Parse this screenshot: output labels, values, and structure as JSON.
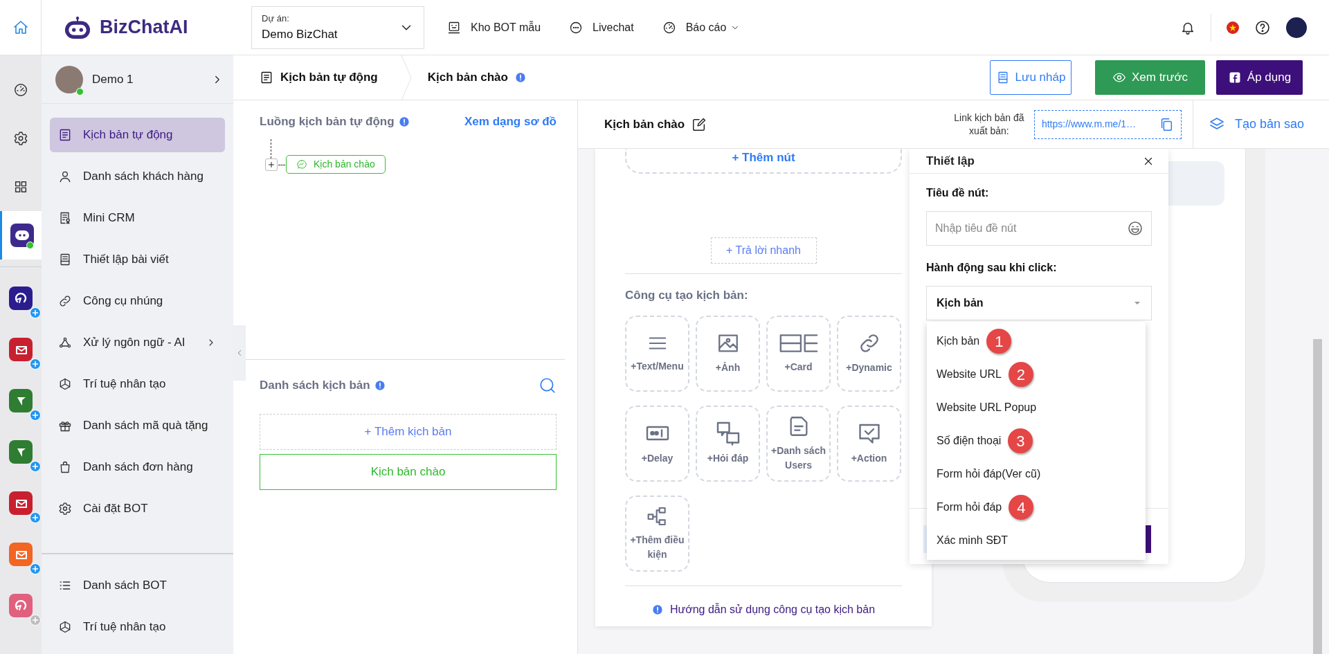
{
  "header": {
    "logo": "BizChatAI",
    "project": {
      "label": "Dự án:",
      "value": "Demo BizChat"
    },
    "nav": [
      {
        "label": "Kho BOT mẫu",
        "dropdown": false
      },
      {
        "label": "Livechat",
        "dropdown": false
      },
      {
        "label": "Báo cáo",
        "dropdown": true
      }
    ]
  },
  "rail": {
    "items": [
      {
        "selected": false,
        "online": false
      },
      {
        "selected": false,
        "online": false
      },
      {
        "selected": false,
        "online": false
      },
      {
        "selected": true,
        "online": true
      }
    ],
    "apps": [
      {
        "color": "#2b1d8e",
        "enabled": true
      },
      {
        "color": "#c8202f",
        "enabled": true
      },
      {
        "color": "#2e7d32",
        "enabled": true
      },
      {
        "color": "#2e7d32",
        "enabled": true
      },
      {
        "color": "#c8202f",
        "enabled": true
      },
      {
        "color": "#f26522",
        "enabled": true
      },
      {
        "color": "#e0607e",
        "enabled": false
      }
    ]
  },
  "sidebar": {
    "profile": {
      "name": "Demo 1",
      "online": true
    },
    "items": [
      {
        "label": "Kịch bản tự động",
        "selected": true,
        "submenu": false
      },
      {
        "label": "Danh sách khách hàng",
        "selected": false,
        "submenu": false
      },
      {
        "label": "Mini CRM",
        "selected": false,
        "submenu": false
      },
      {
        "label": "Thiết lập bài viết",
        "selected": false,
        "submenu": false
      },
      {
        "label": "Công cụ nhúng",
        "selected": false,
        "submenu": false
      },
      {
        "label": "Xử lý ngôn ngữ - AI",
        "selected": false,
        "submenu": true
      },
      {
        "label": "Trí tuệ nhân tạo",
        "selected": false,
        "submenu": false
      },
      {
        "label": "Danh sách mã quà tặng",
        "selected": false,
        "submenu": false
      },
      {
        "label": "Danh sách đơn hàng",
        "selected": false,
        "submenu": false
      },
      {
        "label": "Cài đặt BOT",
        "selected": false,
        "submenu": false
      }
    ],
    "bottom_items": [
      {
        "label": "Danh sách BOT",
        "selected": false
      },
      {
        "label": "Trí tuệ nhân tạo",
        "selected": false
      }
    ]
  },
  "breadcrumb": [
    {
      "label": "Kịch bản tự động",
      "info": false
    },
    {
      "label": "Kịch bản chào",
      "info": true
    }
  ],
  "actions": [
    {
      "label": "Lưu nháp",
      "kind": "draft"
    },
    {
      "label": "Xem trước",
      "kind": "preview"
    },
    {
      "label": "Áp dụng",
      "kind": "apply"
    }
  ],
  "flow": {
    "title": "Luồng kịch bản tự động",
    "view_link": "Xem dạng sơ đồ",
    "tree": [
      {
        "label": "Kịch bản chào"
      }
    ]
  },
  "scripts": {
    "title": "Danh sách kịch bản",
    "add": "+ Thêm kịch bản",
    "items": [
      {
        "label": "Kịch bản chào",
        "selected": true
      }
    ]
  },
  "editor": {
    "title": "Kịch bản chào",
    "link_label": "Link kịch bản đã xuất bản:",
    "link": "https://www.m.me/1…",
    "duplicate": "Tạo bản sao"
  },
  "builder": {
    "add_button": "+ Thêm nút",
    "quick_reply": "+ Trả lời nhanh",
    "tools_title": "Công cụ tạo kịch bản:",
    "tools": [
      {
        "label": "+Text/Menu"
      },
      {
        "label": "+Ảnh"
      },
      {
        "label": "+Card"
      },
      {
        "label": "+Dynamic"
      },
      {
        "label": "+Delay"
      },
      {
        "label": "+Hỏi đáp"
      },
      {
        "label": "+Danh sách Users"
      },
      {
        "label": "+Action"
      },
      {
        "label": "+Thêm điều kiện"
      }
    ],
    "help": "Hướng dẫn sử dụng công cụ tạo kịch bản"
  },
  "settings": {
    "title": "Thiết lập",
    "button_title": {
      "label": "Tiêu đề nút:",
      "placeholder": "Nhập tiêu đề nút"
    },
    "action": {
      "label": "Hành động sau khi click:",
      "value": "Kịch bản",
      "expanded": true,
      "options": [
        {
          "label": "Kịch bản",
          "marker": "1"
        },
        {
          "label": "Website URL",
          "marker": "2"
        },
        {
          "label": "Website URL Popup"
        },
        {
          "label": "Số điện thoại",
          "marker": "3"
        },
        {
          "label": "Form hỏi đáp(Ver cũ)"
        },
        {
          "label": "Form hỏi đáp",
          "marker": "4"
        },
        {
          "label": "Xác minh SĐT"
        }
      ]
    }
  }
}
